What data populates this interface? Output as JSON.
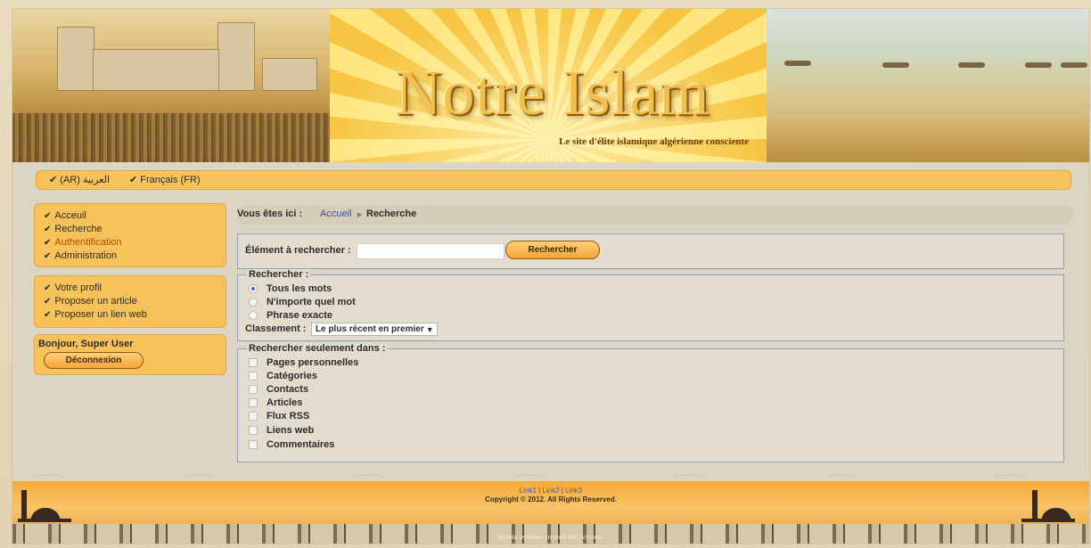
{
  "header": {
    "title": "Notre Islam",
    "tagline": "Le site d'élite islamique algérienne consciente"
  },
  "languages": [
    {
      "label": "العربية (AR)"
    },
    {
      "label": "Français (FR)"
    }
  ],
  "sidebar": {
    "main_menu": [
      {
        "label": "Acceuil"
      },
      {
        "label": "Recherche"
      },
      {
        "label": "Authentification",
        "active": true
      },
      {
        "label": "Administration"
      }
    ],
    "user_menu": [
      {
        "label": "Votre profil"
      },
      {
        "label": "Proposer un article"
      },
      {
        "label": "Proposer un lien web"
      }
    ],
    "login": {
      "greeting": "Bonjour, Super User",
      "logout_label": "Déconnexion"
    }
  },
  "breadcrumb": {
    "prefix": "Vous êtes ici :",
    "home": "Accueil",
    "separator": "▸",
    "current": "Recherche"
  },
  "search": {
    "label": "Élément à rechercher :",
    "value": "",
    "button_label": "Rechercher"
  },
  "options": {
    "legend": "Rechercher :",
    "modes": [
      {
        "label": "Tous les mots",
        "checked": true
      },
      {
        "label": "N'importe quel mot",
        "checked": false
      },
      {
        "label": "Phrase exacte",
        "checked": false
      }
    ],
    "ordering_label": "Classement :",
    "ordering_value": "Le plus récent en premier"
  },
  "areas": {
    "legend": "Rechercher seulement dans :",
    "items": [
      {
        "label": "Pages personnelles"
      },
      {
        "label": "Catégories"
      },
      {
        "label": "Contacts"
      },
      {
        "label": "Articles"
      },
      {
        "label": "Flux RSS"
      },
      {
        "label": "Liens web"
      },
      {
        "label": "Commentaires"
      }
    ]
  },
  "footer": {
    "links": [
      "Link1",
      "Link2",
      "Link3"
    ],
    "link_separator": "|",
    "copyright": "Copyright © 2012. All Rights Reserved.",
    "credit": "Joomla template created with Artisteer."
  },
  "colors": {
    "accent": "#f7c25a",
    "active_link": "#b24a00",
    "link": "#3a4da0"
  }
}
